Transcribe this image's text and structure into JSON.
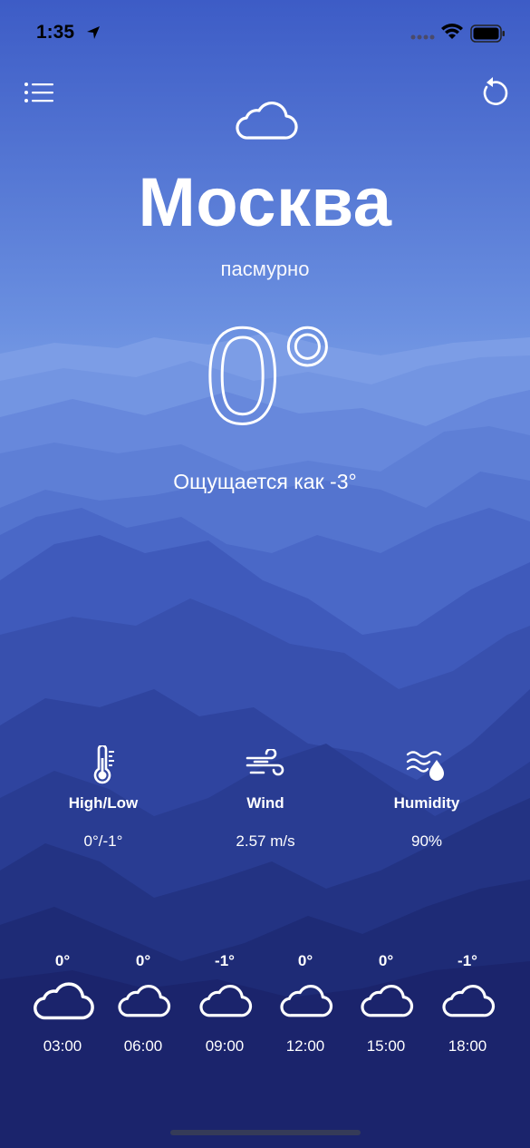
{
  "status_bar": {
    "time": "1:35"
  },
  "weather": {
    "city": "Москва",
    "condition": "пасмурно",
    "temperature": "0°",
    "feels_like": "Ощущается как -3°",
    "icon": "cloud-icon"
  },
  "stats": [
    {
      "icon": "thermometer-icon",
      "label": "High/Low",
      "value": "0°/-1°"
    },
    {
      "icon": "wind-icon",
      "label": "Wind",
      "value": "2.57 m/s"
    },
    {
      "icon": "humidity-icon",
      "label": "Humidity",
      "value": "90%"
    }
  ],
  "forecast": [
    {
      "temp": "0°",
      "time": "03:00",
      "icon": "cloud-icon"
    },
    {
      "temp": "0°",
      "time": "06:00",
      "icon": "cloud-icon"
    },
    {
      "temp": "-1°",
      "time": "09:00",
      "icon": "cloud-icon"
    },
    {
      "temp": "0°",
      "time": "12:00",
      "icon": "cloud-icon"
    },
    {
      "temp": "0°",
      "time": "15:00",
      "icon": "cloud-icon"
    },
    {
      "temp": "-1°",
      "time": "18:00",
      "icon": "cloud-icon"
    }
  ],
  "colors": {
    "sky_top": "#3f5fc8",
    "sky_mid": "#6f95e0",
    "mountain_dark": "#1b2268",
    "text": "#ffffff"
  }
}
